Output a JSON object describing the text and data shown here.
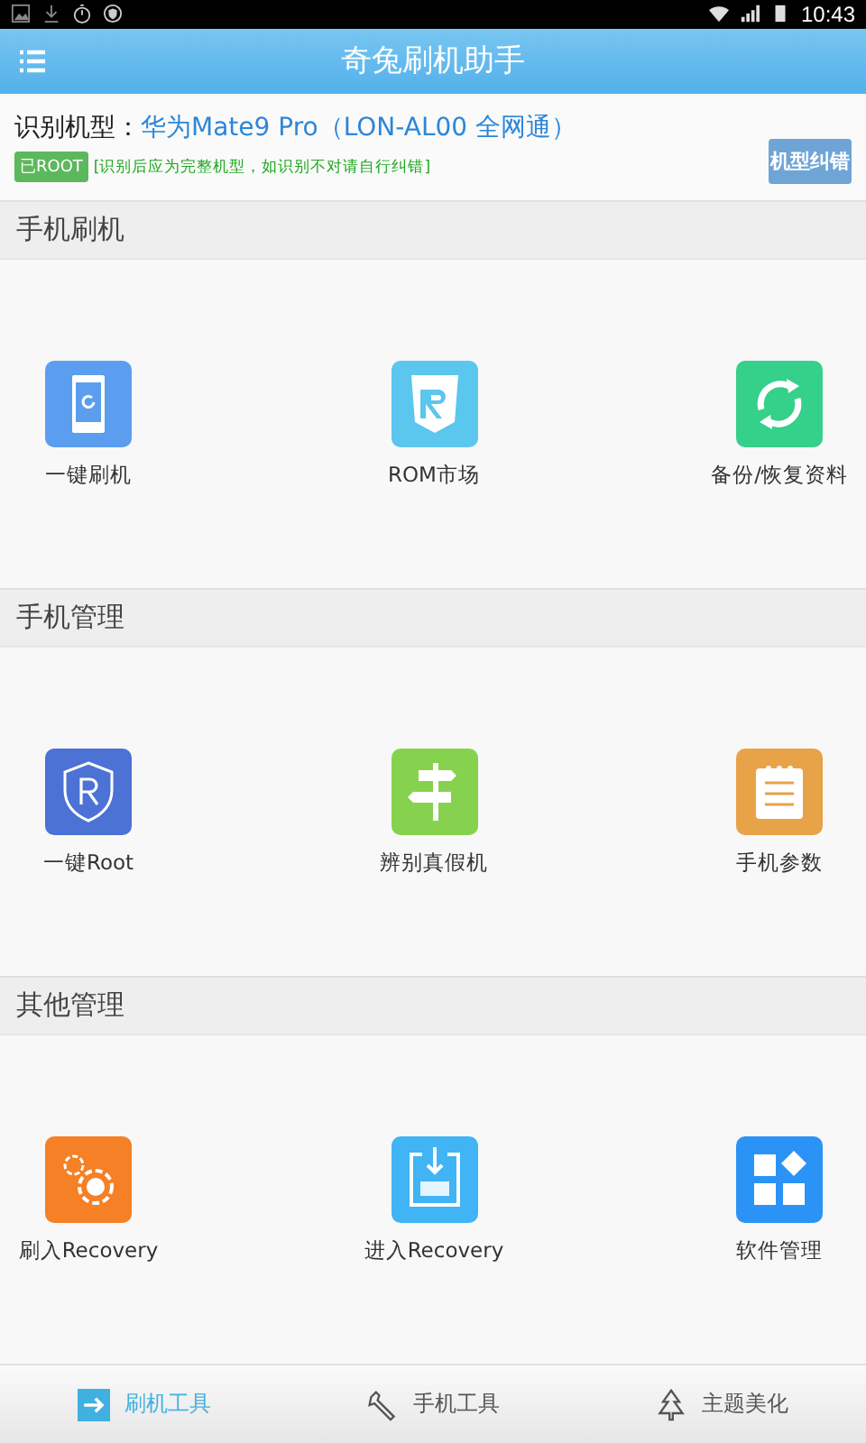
{
  "status_bar": {
    "time": "10:43"
  },
  "app_bar": {
    "title": "奇兔刷机助手"
  },
  "device": {
    "label": "识别机型：",
    "model": "华为Mate9 Pro（LON-AL00 全网通）",
    "root_badge": "已ROOT",
    "hint": "[识别后应为完整机型，如识别不对请自行纠错]",
    "correct_button": "机型纠错"
  },
  "sections": [
    {
      "title": "手机刷机",
      "items": [
        {
          "kind": "flash",
          "label": "一键刷机"
        },
        {
          "kind": "rom",
          "label": "ROM市场"
        },
        {
          "kind": "backup",
          "label": "备份/恢复资料"
        }
      ]
    },
    {
      "title": "手机管理",
      "items": [
        {
          "kind": "root",
          "label": "一键Root"
        },
        {
          "kind": "signpost",
          "label": "辨别真假机"
        },
        {
          "kind": "params",
          "label": "手机参数"
        }
      ]
    },
    {
      "title": "其他管理",
      "items": [
        {
          "kind": "flashrec",
          "label": "刷入Recovery"
        },
        {
          "kind": "enterrec",
          "label": "进入Recovery"
        },
        {
          "kind": "apps",
          "label": "软件管理"
        }
      ]
    }
  ],
  "tabs": [
    {
      "kind": "arrow",
      "label": "刷机工具",
      "selected": true
    },
    {
      "kind": "wrench",
      "label": "手机工具",
      "selected": false
    },
    {
      "kind": "tree",
      "label": "主题美化",
      "selected": false
    }
  ]
}
